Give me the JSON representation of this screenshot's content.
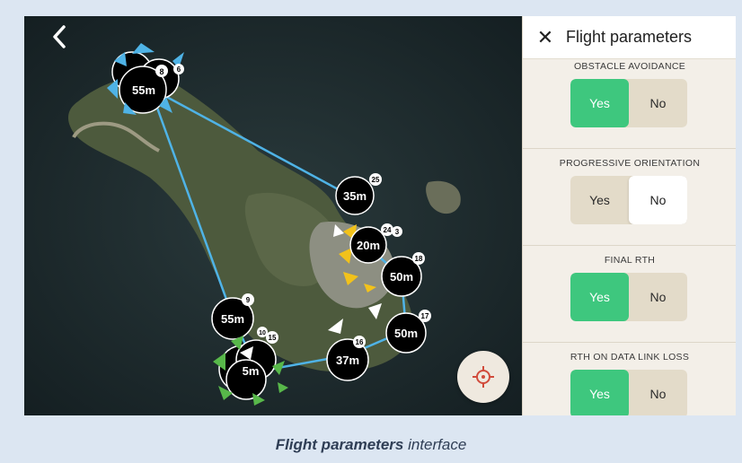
{
  "panel": {
    "title": "Flight parameters",
    "params": [
      {
        "label": "OBSTACLE AVOIDANCE",
        "yes": "Yes",
        "no": "No",
        "selected": "yes"
      },
      {
        "label": "PROGRESSIVE ORIENTATION",
        "yes": "Yes",
        "no": "No",
        "selected": "no"
      },
      {
        "label": "FINAL RTH",
        "yes": "Yes",
        "no": "No",
        "selected": "yes"
      },
      {
        "label": "RTH ON DATA LINK LOSS",
        "yes": "Yes",
        "no": "No",
        "selected": "yes"
      }
    ]
  },
  "map": {
    "waypoints": [
      {
        "alt": "55m",
        "num": "8",
        "num2": "6"
      },
      {
        "alt": "35m",
        "num": "25"
      },
      {
        "alt": "20m",
        "num": "24",
        "num2": "3"
      },
      {
        "alt": "50m",
        "num": "18"
      },
      {
        "alt": "55m",
        "num": "9"
      },
      {
        "alt": "50m",
        "num": "17"
      },
      {
        "alt": "37m",
        "num": "16"
      },
      {
        "alt": "5m",
        "num": "10",
        "num2": "15"
      }
    ]
  },
  "caption": {
    "bold": "Flight parameters",
    "rest": " interface"
  },
  "colors": {
    "accent_green": "#3ec77e",
    "route_blue": "#4fb3e6",
    "marker_yellow": "#f2c21b",
    "marker_green": "#58b84a"
  },
  "icons": {
    "back": "chevron-left-icon",
    "close": "close-icon",
    "locate": "target-icon"
  }
}
